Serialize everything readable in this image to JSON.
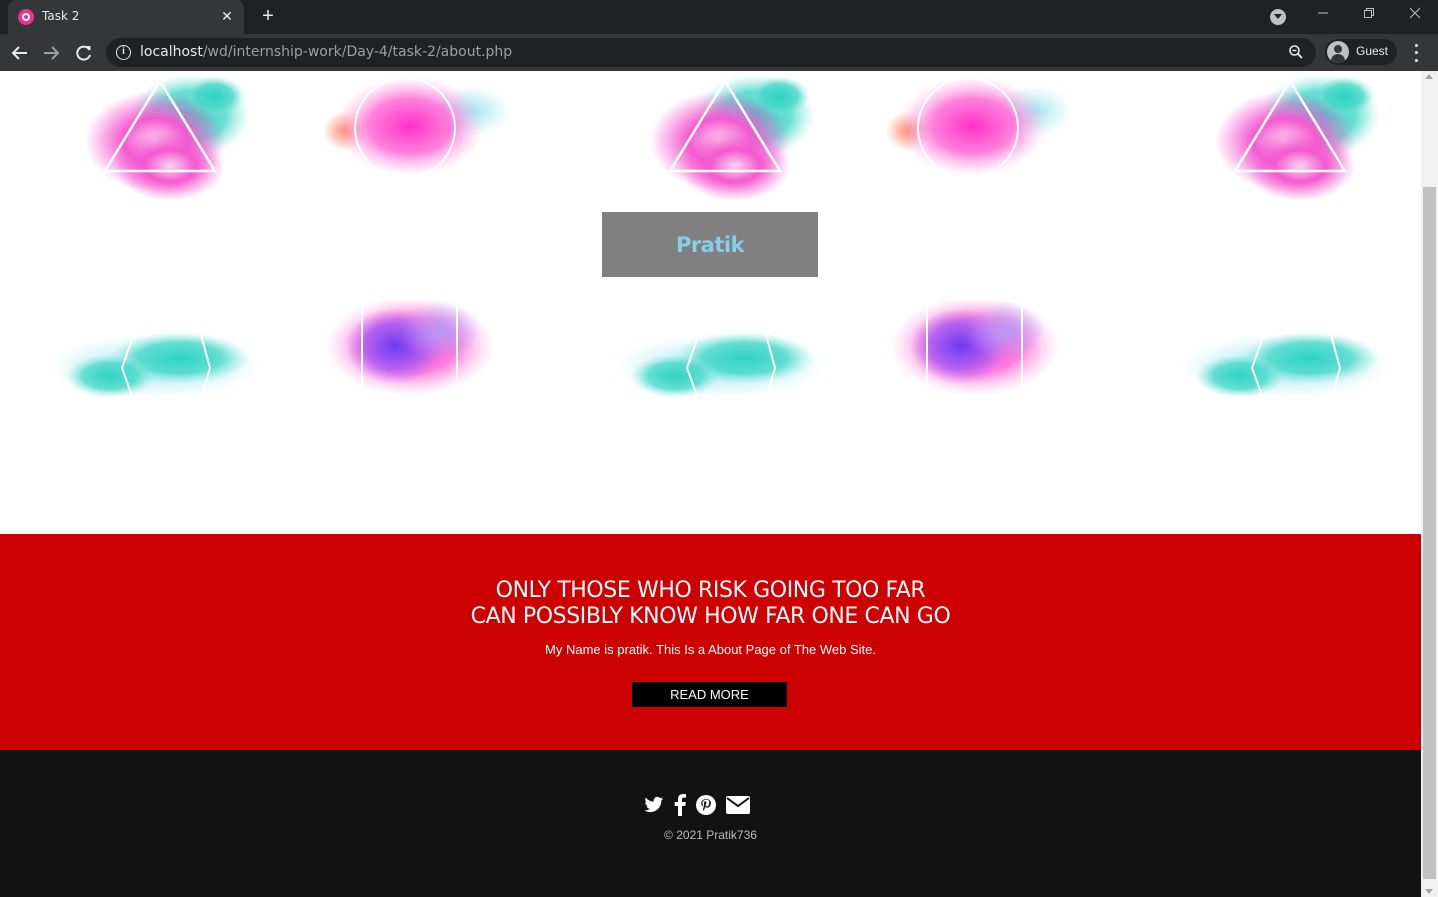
{
  "browser": {
    "tab_title": "Task 2",
    "url_host": "localhost",
    "url_path": "/wd/internship-work/Day-4/task-2/about.php",
    "profile_label": "Guest",
    "new_tab_glyph": "+",
    "close_glyph": "✕"
  },
  "page": {
    "name_box_label": "Pratik",
    "quote_line_1": "ONLY THOSE WHO RISK GOING TOO FAR",
    "quote_line_2": "CAN POSSIBLY KNOW HOW FAR ONE CAN GO",
    "about_text": "My Name is pratik. This Is a About Page of The Web Site.",
    "read_more_label": "READ MORE",
    "social_icons": [
      "twitter-icon",
      "facebook-icon",
      "pinterest-icon",
      "envelope-icon"
    ],
    "copyright": "© 2021 Pratik736"
  },
  "colors": {
    "quote_band": "#cc0000",
    "footer": "#121212",
    "name_box": "#808080",
    "name_text": "#87ceeb",
    "button": "#000000"
  }
}
